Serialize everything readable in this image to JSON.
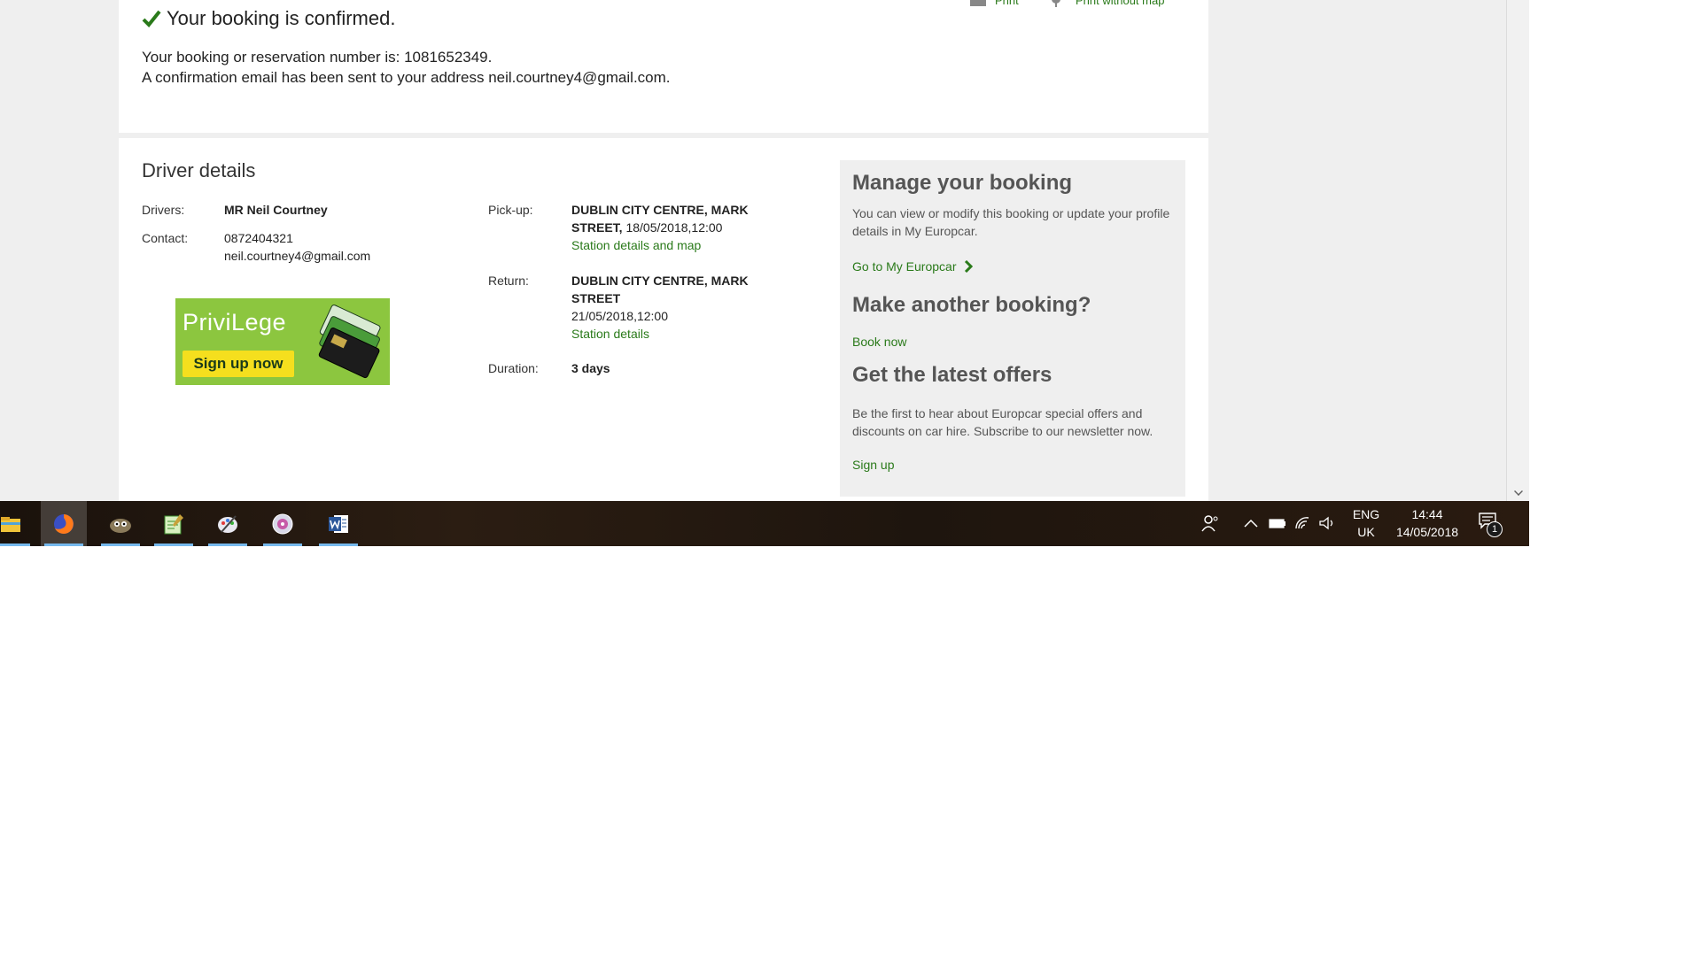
{
  "header": {
    "confirmed": "Your booking is confirmed.",
    "print": "Print",
    "print_no_map": "Print without map",
    "booking_number_line": "Your booking or reservation number is: 1081652349.",
    "email_line": "A confirmation email has been sent to your address neil.courtney4@gmail.com."
  },
  "driver": {
    "title": "Driver details",
    "drivers_label": "Drivers:",
    "drivers_value": "MR Neil Courtney",
    "contact_label": "Contact:",
    "phone": "0872404321",
    "email": "neil.courtney4@gmail.com"
  },
  "promo": {
    "brand": "PriviLege",
    "cta": "Sign up now"
  },
  "rental": {
    "pickup_label": "Pick-up:",
    "pickup_location_1": "DUBLIN CITY CENTRE, MARK",
    "pickup_location_2": "STREET,",
    "pickup_datetime": "18/05/2018,12:00",
    "pickup_link": "Station details and map",
    "return_label": "Return:",
    "return_location_1": "DUBLIN CITY CENTRE, MARK",
    "return_location_2": "STREET",
    "return_datetime": "21/05/2018,12:00",
    "return_link": "Station details",
    "duration_label": "Duration:",
    "duration_value": "3 days"
  },
  "side": {
    "manage_title": "Manage your booking",
    "manage_text": "You can view or modify this booking or update your profile details in My Europcar.",
    "manage_link": "Go to My Europcar",
    "another_title": "Make another booking?",
    "another_link": "Book now",
    "offers_title": "Get the latest offers",
    "offers_text": "Be the first to hear about Europcar special offers and discounts on car hire. Subscribe to our newsletter now.",
    "offers_link": "Sign up"
  },
  "taskbar": {
    "apps": [
      "file-explorer",
      "firefox",
      "gimp",
      "notepad-plus",
      "paint-tool",
      "media-app",
      "word"
    ],
    "lang_1": "ENG",
    "lang_2": "UK",
    "time": "14:44",
    "date": "14/05/2018",
    "notification_count": "1"
  },
  "colors": {
    "accent_green": "#2a7a1a",
    "promo_green": "#8cc63f",
    "promo_yellow": "#f5df1e"
  }
}
